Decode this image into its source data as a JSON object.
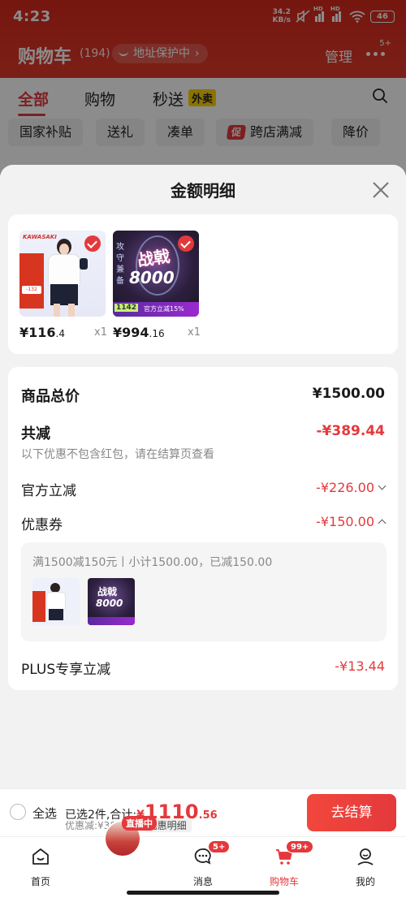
{
  "status_bar": {
    "time": "4:23",
    "net_speed_value": "34.2",
    "net_speed_unit": "KB/s",
    "signal_label": "HD",
    "battery": "46"
  },
  "header": {
    "title": "购物车",
    "count": "(194)",
    "address_protection": "地址保护中",
    "manage": "管理",
    "more_badge": "5+"
  },
  "tabs": [
    {
      "label": "全部",
      "active": true
    },
    {
      "label": "购物",
      "active": false
    },
    {
      "label": "秒送",
      "active": false,
      "tag": "外卖"
    }
  ],
  "chips": [
    "国家补贴",
    "送礼",
    "凑单",
    "跨店满减",
    "降价"
  ],
  "chip_promo_icon": "促",
  "sheet": {
    "title": "金额明细",
    "products": [
      {
        "price_main": "¥116",
        "price_decimal": ".4",
        "qty": "x1"
      },
      {
        "price_main": "¥994",
        "price_decimal": ".16",
        "qty": "x1"
      }
    ],
    "product_art": {
      "brand": "KAWASAKI",
      "p1_tag": "-132",
      "p2_title": "战戟",
      "p2_number": "8000",
      "p2_side": "攻守兼备",
      "p2_price_tag": "1142",
      "p2_promo": "官方立减15%"
    },
    "summary": {
      "goods_total_label": "商品总价",
      "goods_total_value": "¥1500.00",
      "total_reduce_label": "共减",
      "total_reduce_value": "-¥389.44",
      "reduce_note": "以下优惠不包含红包，请在结算页查看",
      "official_label": "官方立减",
      "official_value": "-¥226.00",
      "coupon_label": "优惠券",
      "coupon_value": "-¥150.00",
      "coupon_detail": "满1500减150元丨小计1500.00，已减150.00",
      "plus_label": "PLUS专享立减",
      "plus_value": "-¥13.44"
    }
  },
  "checkout": {
    "select_all": "全选",
    "selected_prefix": "已选2件,合计:",
    "total_symbol": "¥",
    "total_main": "1110",
    "total_decimal": ".56",
    "discount": "优惠减:¥389.44",
    "detail_button": "优惠明细",
    "pay_button": "去结算"
  },
  "bottom_nav": {
    "live_tag": "直播中",
    "items": [
      {
        "label": "首页"
      },
      {
        "label": "消息",
        "badge": "5+"
      },
      {
        "label": "购物车",
        "badge": "99+",
        "active": true
      },
      {
        "label": "我的"
      }
    ]
  },
  "colors": {
    "brand_red": "#e4393c",
    "header_red": "#d62a1c"
  }
}
